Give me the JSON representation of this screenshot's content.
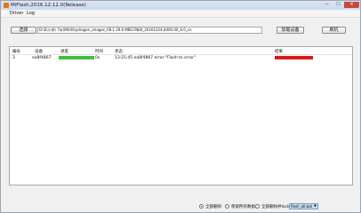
{
  "window": {
    "title": "MiFlash.2016.12.12.0(Release)"
  },
  "menu": [
    "Driver",
    "Log"
  ],
  "toolbar": {
    "select_label": "选择",
    "path_value": "D:\\E\\小米\\ 7ar\\MIUI\\hydrogen_images_V8.1.29.0.MBCCNEK_20161224.0000.00_6.0_cn",
    "install_driver_label": "加载设备",
    "flash_label": "刷机"
  },
  "table": {
    "headers": [
      "编号",
      "设备",
      "进度",
      "时间",
      "状态",
      "结果"
    ],
    "rows": [
      {
        "id": "3",
        "device": "ea8f4867",
        "progress": 1.0,
        "time": "0s",
        "status": "13:21:45  ea8f4867 error:\"Flash to error\"",
        "result": "error"
      }
    ]
  },
  "footer": {
    "options": [
      "全部删除",
      "保留所有数据",
      "全部删除并lock"
    ],
    "selected_index": 0,
    "script_selected": "flash_all.bat"
  },
  "colors": {
    "progress_fill": "#3fc03f",
    "result_error": "#e01818",
    "close_button": "#c9483a"
  }
}
